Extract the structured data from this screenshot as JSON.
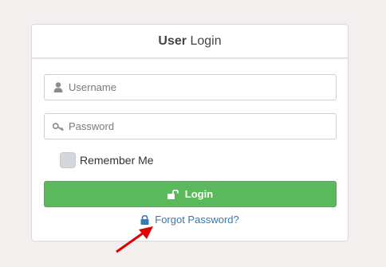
{
  "panel": {
    "title_bold": "User",
    "title_rest": "Login"
  },
  "form": {
    "username": {
      "placeholder": "Username",
      "value": "",
      "icon": "user-icon"
    },
    "password": {
      "placeholder": "Password",
      "value": "",
      "icon": "key-icon"
    },
    "remember_label": "Remember Me",
    "remember_checked": false,
    "login_label": "Login",
    "login_icon": "unlock-icon",
    "forgot_label": "Forgot Password?",
    "forgot_icon": "lock-icon"
  },
  "annotation": {
    "arrow_icon": "red-arrow-icon",
    "arrow_color": "#e00000"
  },
  "colors": {
    "background": "#f2efee",
    "button_green": "#5cb85c",
    "link_blue": "#337ab7"
  }
}
